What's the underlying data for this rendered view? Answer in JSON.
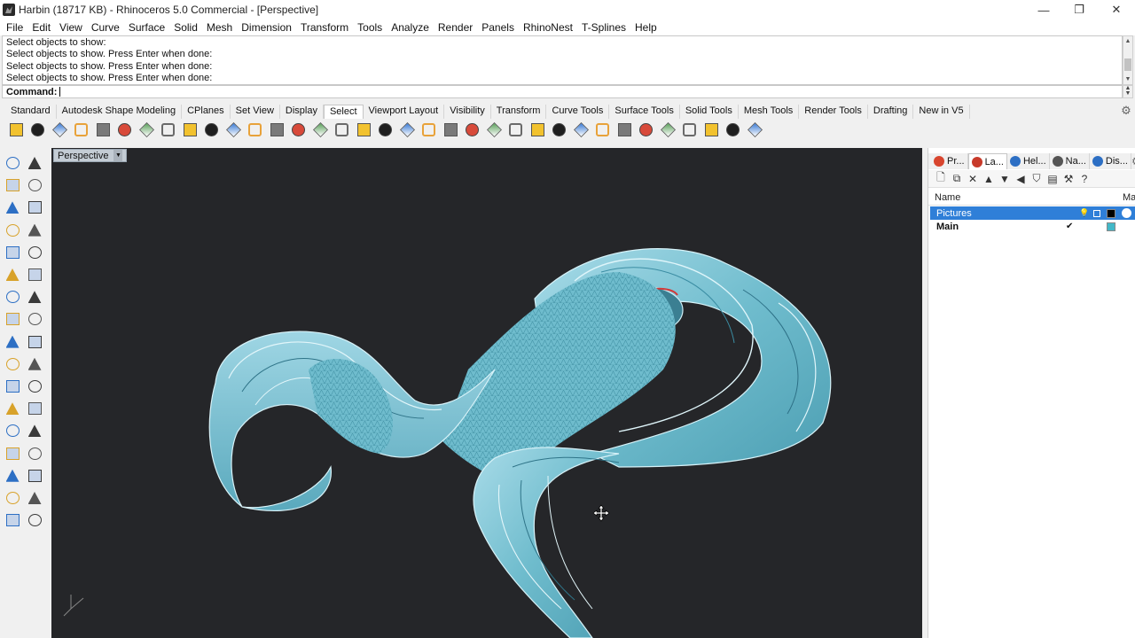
{
  "window": {
    "title": "Harbin (18717 KB) - Rhinoceros 5.0 Commercial - [Perspective]",
    "controls": {
      "minimize": "—",
      "restore": "❐",
      "close": "✕"
    }
  },
  "menu": [
    "File",
    "Edit",
    "View",
    "Curve",
    "Surface",
    "Solid",
    "Mesh",
    "Dimension",
    "Transform",
    "Tools",
    "Analyze",
    "Render",
    "Panels",
    "RhinoNest",
    "T-Splines",
    "Help"
  ],
  "command": {
    "history": [
      "Select objects to show:",
      "Select objects to show. Press Enter when done:",
      "Select objects to show. Press Enter when done:",
      "Select objects to show. Press Enter when done:"
    ],
    "prompt": "Command:"
  },
  "toolbar_tabs": {
    "items": [
      "Standard",
      "Autodesk Shape Modeling",
      "CPlanes",
      "Set View",
      "Display",
      "Select",
      "Viewport Layout",
      "Visibility",
      "Transform",
      "Curve Tools",
      "Surface Tools",
      "Solid Tools",
      "Mesh Tools",
      "Render Tools",
      "Drafting",
      "New in V5"
    ],
    "active": "Select"
  },
  "toolbar_icons": [
    "select-points-icon",
    "select-all-icon",
    "select-last-icon",
    "select-curves-icon",
    "select-polysurface-icon",
    "select-lines-icon",
    "select-blocks-icon",
    "select-dimensions-icon",
    "select-surfaces-icon",
    "select-color-icon",
    "select-open-icon",
    "select-mesh-icon",
    "select-points-cloud-icon",
    "select-control-points-icon",
    "select-closed-icon",
    "select-light-icon",
    "select-grips-icon",
    "select-hatch-icon",
    "select-layer-icon",
    "select-group-icon",
    "select-sphere-icon",
    "select-box-icon",
    "select-plane-icon",
    "select-text-icon",
    "select-spiral-icon",
    "select-annotation-icon",
    "select-chain-icon",
    "select-paint-icon",
    "select-sphere-gray-icon",
    "select-cube-icon",
    "select-gumball-icon",
    "select-gear-icon",
    "select-brush-icon",
    "select-zoom-icon",
    "select-filter-icon"
  ],
  "toolbox_icons": [
    "pointer-icon",
    "point-icon",
    "polyline-icon",
    "curve-icon",
    "circle-icon",
    "ellipse-icon",
    "arc-icon",
    "rectangle-icon",
    "polygon-icon",
    "freeform-icon",
    "surface-icon",
    "extrude-icon",
    "box-icon",
    "sphere-icon",
    "cylinder-icon",
    "surface-corners-icon",
    "boolean-icon",
    "explode-icon",
    "split-icon",
    "trim-icon",
    "fillet-icon",
    "solid-tools-icon",
    "offset-icon",
    "project-icon",
    "text-icon",
    "snap-icon",
    "block-icon",
    "mirror-icon",
    "array-icon",
    "dimension-icon",
    "analyze-icon",
    "check-icon",
    "render-icon",
    "layer-tool-icon"
  ],
  "viewport": {
    "label": "Perspective",
    "background": "#252629",
    "surface_color": "#86c8d8"
  },
  "panel": {
    "tabs": [
      {
        "label": "Pr...",
        "icon": "properties-icon"
      },
      {
        "label": "La...",
        "icon": "layers-icon"
      },
      {
        "label": "Hel...",
        "icon": "help-icon"
      },
      {
        "label": "Na...",
        "icon": "named-view-icon"
      },
      {
        "label": "Dis...",
        "icon": "display-icon"
      }
    ],
    "active_tab": "La...",
    "columns": {
      "name": "Name",
      "material": "Ma"
    },
    "layers": [
      {
        "name": "Pictures",
        "selected": true,
        "current": false,
        "color": "#000000"
      },
      {
        "name": "Main",
        "selected": false,
        "current": true,
        "color": "#43b8c8"
      }
    ]
  }
}
